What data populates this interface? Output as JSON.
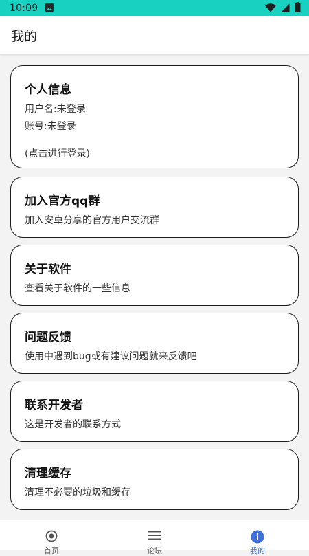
{
  "status_bar": {
    "time": "10:09",
    "icons": [
      "image-icon",
      "wifi-icon",
      "signal-icon",
      "battery-icon"
    ]
  },
  "app_bar": {
    "title": "我的"
  },
  "cards": [
    {
      "title": "个人信息",
      "lines": [
        "用户名:未登录",
        "账号:未登录"
      ],
      "hint": "(点击进行登录)"
    },
    {
      "title": "加入官方qq群",
      "lines": [
        "加入安卓分享的官方用户交流群"
      ]
    },
    {
      "title": "关于软件",
      "lines": [
        "查看关于软件的一些信息"
      ]
    },
    {
      "title": "问题反馈",
      "lines": [
        "使用中遇到bug或有建议问题就来反馈吧"
      ]
    },
    {
      "title": "联系开发者",
      "lines": [
        "这是开发者的联系方式"
      ]
    },
    {
      "title": "清理缓存",
      "lines": [
        "清理不必要的垃圾和缓存"
      ]
    }
  ],
  "bottom_nav": {
    "items": [
      {
        "label": "首页",
        "icon": "radio-circle-icon",
        "active": false
      },
      {
        "label": "论坛",
        "icon": "menu-lines-icon",
        "active": false
      },
      {
        "label": "我的",
        "icon": "info-icon",
        "active": true
      }
    ]
  },
  "colors": {
    "status_bar": "#19d1c0",
    "accent": "#3f6fd8",
    "card_border": "#1d1d1d"
  }
}
